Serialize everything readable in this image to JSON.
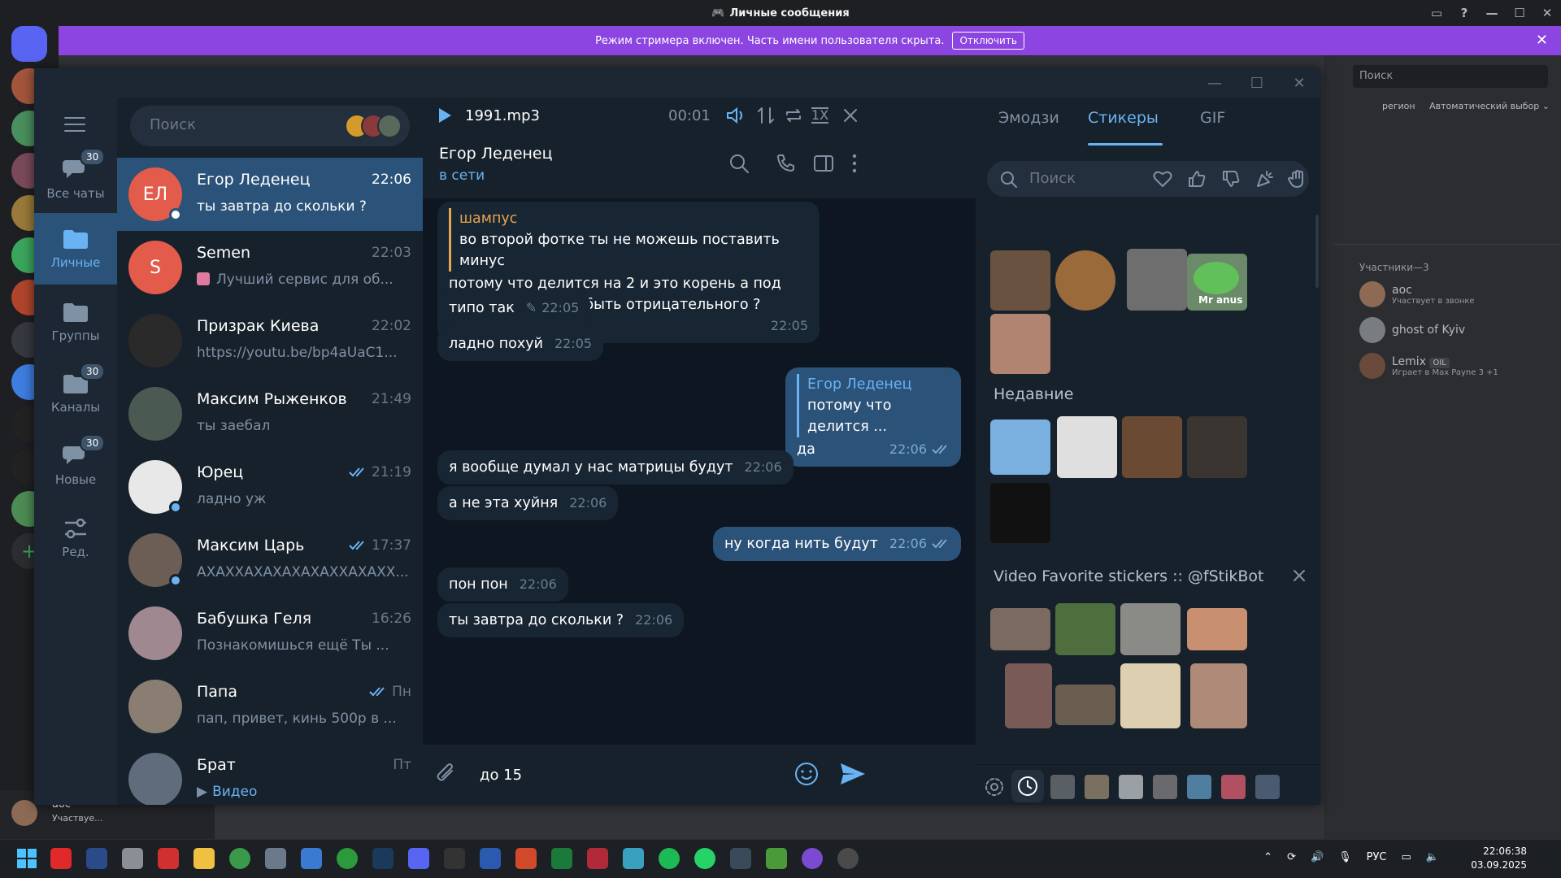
{
  "discord": {
    "window_title": "Личные сообщения",
    "streamer_banner": "Режим стримера включен. Часть имени пользователя скрыта.",
    "disable_button": "Отключить",
    "search_placeholder": "Поиск",
    "region_label": "регион",
    "region_value": "Автоматический выбор",
    "members_header": "Участники—3",
    "members": [
      {
        "name": "aoc",
        "status": "Участвует в звонке"
      },
      {
        "name": "ghost of Kyiv",
        "status": ""
      },
      {
        "name": "Lemix",
        "tag": "OIL",
        "status": "Играет в Max Payne 3 +1"
      }
    ],
    "user_name": "aoc",
    "user_status": "Участвуе..."
  },
  "telegram": {
    "search_placeholder": "Поиск",
    "nav": [
      {
        "label": "Все чаты",
        "badge": "30",
        "icon": "chats-icon"
      },
      {
        "label": "Личные",
        "badge": "",
        "icon": "folder-icon"
      },
      {
        "label": "Группы",
        "badge": "",
        "icon": "folder-icon"
      },
      {
        "label": "Каналы",
        "badge": "30",
        "icon": "folder-icon"
      },
      {
        "label": "Новые",
        "badge": "30",
        "icon": "chats-icon"
      },
      {
        "label": "Ред.",
        "badge": "",
        "icon": "sliders-icon"
      }
    ],
    "chats": [
      {
        "name": "Егор Леденец",
        "initials": "ЕЛ",
        "time": "22:06",
        "preview": "ты завтра до скольки ?",
        "online": true,
        "read": false,
        "color": "#e35b4b"
      },
      {
        "name": "Semen",
        "initials": "S",
        "time": "22:03",
        "preview": "Лучший сервис для об...",
        "online": false,
        "read": false,
        "color": "#e35b4b"
      },
      {
        "name": "Призрак Киева",
        "initials": "",
        "time": "22:02",
        "preview": "https://youtu.be/bp4aUaC1...",
        "online": false,
        "read": false,
        "color": "#2a2a2a"
      },
      {
        "name": "Максим Рыженков",
        "initials": "",
        "time": "21:49",
        "preview": "ты заебал",
        "online": false,
        "read": false,
        "color": "#4a5a52"
      },
      {
        "name": "Юрец",
        "initials": "",
        "time": "21:19",
        "preview": "ладно уж",
        "online": true,
        "read": true,
        "color": "#e8e8e8"
      },
      {
        "name": "Максим Царь",
        "initials": "",
        "time": "17:37",
        "preview": "АХАХХАХАХАХАХАХХАХАХХ...",
        "online": true,
        "read": true,
        "color": "#6c5d55"
      },
      {
        "name": "Бабушка Геля",
        "initials": "",
        "time": "16:26",
        "preview": "Познакомишься ещё  Ты ...",
        "online": false,
        "read": false,
        "color": "#a08890"
      },
      {
        "name": "Папа",
        "initials": "",
        "time": "Пн",
        "preview": "пап, привет, кинь 500р в ...",
        "online": false,
        "read": true,
        "color": "#8a7d72"
      },
      {
        "name": "Брат",
        "initials": "",
        "time": "Пт",
        "preview": "Видео",
        "online": false,
        "read": false,
        "color": "#5e6c7c"
      }
    ],
    "player": {
      "track": "1991.mp3",
      "time": "00:01",
      "speed": "1X"
    },
    "header": {
      "name": "Егор Леденец",
      "status": "в сети"
    },
    "messages": [
      {
        "dir": "in",
        "reply_name": "шампус",
        "reply_text": "во второй фотке ты не можешь поставить минус",
        "text": "потому что делится на 2 и это корень а под корнем не может быть отрицательного ?",
        "time": "22:05"
      },
      {
        "dir": "in",
        "text": "типо так",
        "time": "22:05",
        "edited": true
      },
      {
        "dir": "in",
        "text": "ладно похуй",
        "time": "22:05"
      },
      {
        "dir": "out",
        "reply_name": "Егор Леденец",
        "reply_text": "потому что делится ...",
        "text": "да",
        "time": "22:06"
      },
      {
        "dir": "in",
        "text": "я вообще думал у нас матрицы будут",
        "time": "22:06"
      },
      {
        "dir": "in",
        "text": "а не эта хуйня",
        "time": "22:06"
      },
      {
        "dir": "out",
        "text": "ну когда нить будут",
        "time": "22:06"
      },
      {
        "dir": "in",
        "text": "пон пон",
        "time": "22:06"
      },
      {
        "dir": "in",
        "text": "ты завтра до скольки ?",
        "time": "22:06"
      }
    ],
    "composer_value": "до 15",
    "stickers": {
      "tabs": [
        "Эмодзи",
        "Стикеры",
        "GIF"
      ],
      "search_placeholder": "Поиск",
      "recent_title": "Недавние",
      "pack_title": "Video Favorite stickers :: @fStikBot",
      "sticker_caption": "Mr anus"
    }
  },
  "taskbar": {
    "lang": "РУС",
    "time": "22:06:38",
    "date": "03.09.2025"
  }
}
